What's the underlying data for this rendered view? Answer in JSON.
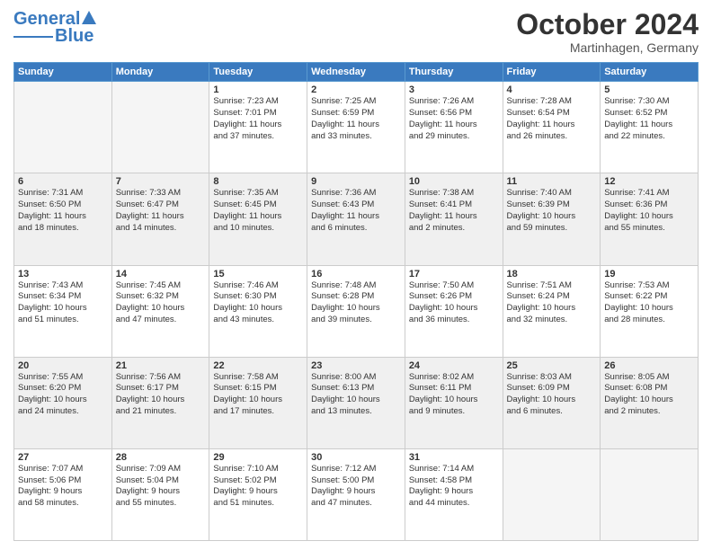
{
  "header": {
    "logo_line1": "General",
    "logo_line2": "Blue",
    "month": "October 2024",
    "location": "Martinhagen, Germany"
  },
  "days_of_week": [
    "Sunday",
    "Monday",
    "Tuesday",
    "Wednesday",
    "Thursday",
    "Friday",
    "Saturday"
  ],
  "weeks": [
    {
      "shaded": false,
      "days": [
        {
          "num": "",
          "content": ""
        },
        {
          "num": "",
          "content": ""
        },
        {
          "num": "1",
          "content": "Sunrise: 7:23 AM\nSunset: 7:01 PM\nDaylight: 11 hours\nand 37 minutes."
        },
        {
          "num": "2",
          "content": "Sunrise: 7:25 AM\nSunset: 6:59 PM\nDaylight: 11 hours\nand 33 minutes."
        },
        {
          "num": "3",
          "content": "Sunrise: 7:26 AM\nSunset: 6:56 PM\nDaylight: 11 hours\nand 29 minutes."
        },
        {
          "num": "4",
          "content": "Sunrise: 7:28 AM\nSunset: 6:54 PM\nDaylight: 11 hours\nand 26 minutes."
        },
        {
          "num": "5",
          "content": "Sunrise: 7:30 AM\nSunset: 6:52 PM\nDaylight: 11 hours\nand 22 minutes."
        }
      ]
    },
    {
      "shaded": true,
      "days": [
        {
          "num": "6",
          "content": "Sunrise: 7:31 AM\nSunset: 6:50 PM\nDaylight: 11 hours\nand 18 minutes."
        },
        {
          "num": "7",
          "content": "Sunrise: 7:33 AM\nSunset: 6:47 PM\nDaylight: 11 hours\nand 14 minutes."
        },
        {
          "num": "8",
          "content": "Sunrise: 7:35 AM\nSunset: 6:45 PM\nDaylight: 11 hours\nand 10 minutes."
        },
        {
          "num": "9",
          "content": "Sunrise: 7:36 AM\nSunset: 6:43 PM\nDaylight: 11 hours\nand 6 minutes."
        },
        {
          "num": "10",
          "content": "Sunrise: 7:38 AM\nSunset: 6:41 PM\nDaylight: 11 hours\nand 2 minutes."
        },
        {
          "num": "11",
          "content": "Sunrise: 7:40 AM\nSunset: 6:39 PM\nDaylight: 10 hours\nand 59 minutes."
        },
        {
          "num": "12",
          "content": "Sunrise: 7:41 AM\nSunset: 6:36 PM\nDaylight: 10 hours\nand 55 minutes."
        }
      ]
    },
    {
      "shaded": false,
      "days": [
        {
          "num": "13",
          "content": "Sunrise: 7:43 AM\nSunset: 6:34 PM\nDaylight: 10 hours\nand 51 minutes."
        },
        {
          "num": "14",
          "content": "Sunrise: 7:45 AM\nSunset: 6:32 PM\nDaylight: 10 hours\nand 47 minutes."
        },
        {
          "num": "15",
          "content": "Sunrise: 7:46 AM\nSunset: 6:30 PM\nDaylight: 10 hours\nand 43 minutes."
        },
        {
          "num": "16",
          "content": "Sunrise: 7:48 AM\nSunset: 6:28 PM\nDaylight: 10 hours\nand 39 minutes."
        },
        {
          "num": "17",
          "content": "Sunrise: 7:50 AM\nSunset: 6:26 PM\nDaylight: 10 hours\nand 36 minutes."
        },
        {
          "num": "18",
          "content": "Sunrise: 7:51 AM\nSunset: 6:24 PM\nDaylight: 10 hours\nand 32 minutes."
        },
        {
          "num": "19",
          "content": "Sunrise: 7:53 AM\nSunset: 6:22 PM\nDaylight: 10 hours\nand 28 minutes."
        }
      ]
    },
    {
      "shaded": true,
      "days": [
        {
          "num": "20",
          "content": "Sunrise: 7:55 AM\nSunset: 6:20 PM\nDaylight: 10 hours\nand 24 minutes."
        },
        {
          "num": "21",
          "content": "Sunrise: 7:56 AM\nSunset: 6:17 PM\nDaylight: 10 hours\nand 21 minutes."
        },
        {
          "num": "22",
          "content": "Sunrise: 7:58 AM\nSunset: 6:15 PM\nDaylight: 10 hours\nand 17 minutes."
        },
        {
          "num": "23",
          "content": "Sunrise: 8:00 AM\nSunset: 6:13 PM\nDaylight: 10 hours\nand 13 minutes."
        },
        {
          "num": "24",
          "content": "Sunrise: 8:02 AM\nSunset: 6:11 PM\nDaylight: 10 hours\nand 9 minutes."
        },
        {
          "num": "25",
          "content": "Sunrise: 8:03 AM\nSunset: 6:09 PM\nDaylight: 10 hours\nand 6 minutes."
        },
        {
          "num": "26",
          "content": "Sunrise: 8:05 AM\nSunset: 6:08 PM\nDaylight: 10 hours\nand 2 minutes."
        }
      ]
    },
    {
      "shaded": false,
      "days": [
        {
          "num": "27",
          "content": "Sunrise: 7:07 AM\nSunset: 5:06 PM\nDaylight: 9 hours\nand 58 minutes."
        },
        {
          "num": "28",
          "content": "Sunrise: 7:09 AM\nSunset: 5:04 PM\nDaylight: 9 hours\nand 55 minutes."
        },
        {
          "num": "29",
          "content": "Sunrise: 7:10 AM\nSunset: 5:02 PM\nDaylight: 9 hours\nand 51 minutes."
        },
        {
          "num": "30",
          "content": "Sunrise: 7:12 AM\nSunset: 5:00 PM\nDaylight: 9 hours\nand 47 minutes."
        },
        {
          "num": "31",
          "content": "Sunrise: 7:14 AM\nSunset: 4:58 PM\nDaylight: 9 hours\nand 44 minutes."
        },
        {
          "num": "",
          "content": ""
        },
        {
          "num": "",
          "content": ""
        }
      ]
    }
  ]
}
